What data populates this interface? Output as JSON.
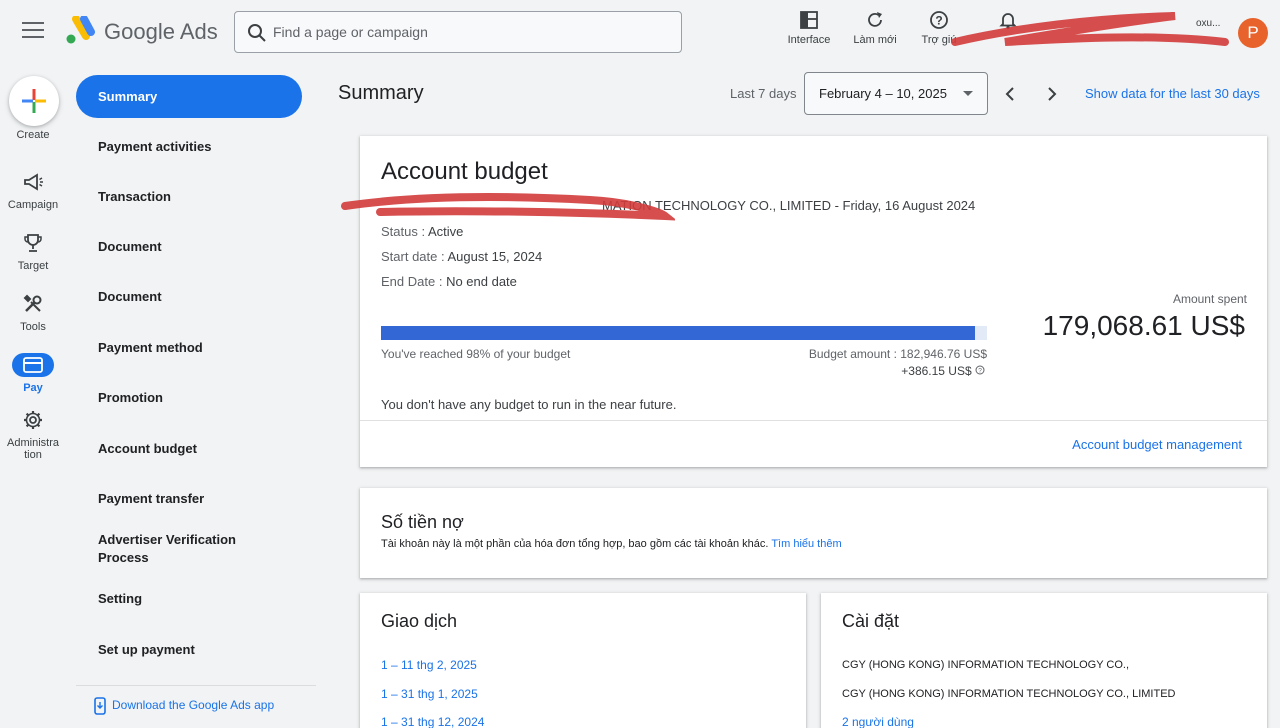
{
  "header": {
    "brand": "Google Ads",
    "search_placeholder": "Find a page or campaign",
    "actions": [
      {
        "label": "Interface",
        "icon": "layout-icon"
      },
      {
        "label": "Làm mới",
        "icon": "refresh-icon"
      },
      {
        "label": "Trợ giú",
        "icon": "help-icon"
      },
      {
        "label": "",
        "icon": "bell-icon"
      }
    ],
    "account_name": "oxu...",
    "avatar_letter": "P"
  },
  "rail": {
    "create": "Create",
    "items": [
      {
        "label": "Campaign",
        "icon": "megaphone-icon"
      },
      {
        "label": "Target",
        "icon": "trophy-icon"
      },
      {
        "label": "Tools",
        "icon": "tools-icon"
      },
      {
        "label": "Pay",
        "icon": "credit-card-icon"
      },
      {
        "label": "Administra tion",
        "icon": "gear-icon"
      }
    ]
  },
  "nav": {
    "items": [
      {
        "label": "Summary",
        "active": true
      },
      {
        "label": "Payment activities"
      },
      {
        "label": "Transaction"
      },
      {
        "label": "Document"
      },
      {
        "label": "Document"
      },
      {
        "label": "Payment method"
      },
      {
        "label": "Promotion"
      },
      {
        "label": "Account budget"
      },
      {
        "label": "Payment transfer"
      },
      {
        "label": "Advertiser Verification Process"
      },
      {
        "label": "Setting"
      },
      {
        "label": "Set up payment"
      }
    ],
    "download": "Download the Google Ads app"
  },
  "page": {
    "title": "Summary",
    "range_label": "Last 7 days",
    "date_range": "February 4 – 10, 2025",
    "last30_link": "Show data for the last 30 days"
  },
  "budget": {
    "title": "Account budget",
    "fund_name": "MATION TECHNOLOGY CO., LIMITED - Friday, 16 August 2024",
    "status_label": "Status :",
    "status": "Active",
    "start_label": "Start date :",
    "start": "August 15, 2024",
    "end_label": "End Date :",
    "end": "No end date",
    "progress_fraction": 0.98,
    "reached_text": "You've reached 98% of your budget",
    "budget_amount": "Budget amount : 182,946.76 US$",
    "budget_extra": "+386.15 US$",
    "amount_spent_label": "Amount spent",
    "amount_spent": "179,068.61 US$",
    "no_budget_text": "You don't have any budget to run in the near future.",
    "management_link": "Account budget management"
  },
  "debt": {
    "title": "Số tiền nợ",
    "description": "Tài khoản này là một phần của hóa đơn tổng hợp, bao gồm các tài khoản khác.",
    "learn_more": "Tìm hiểu thêm"
  },
  "transactions": {
    "title": "Giao dịch",
    "items": [
      "1 – 11 thg 2, 2025",
      "1 – 31 thg 1, 2025",
      "1 – 31 thg 12, 2024"
    ]
  },
  "settings": {
    "title": "Cài đặt",
    "lines": [
      "CGY (HONG KONG) INFORMATION TECHNOLOGY CO.,",
      "CGY (HONG KONG) INFORMATION TECHNOLOGY CO., LIMITED"
    ],
    "users_link": "2 người dùng"
  },
  "colors": {
    "accent": "#1a73e8",
    "progress": "#3367d6",
    "avatar": "#e8622c",
    "redaction": "#d23b3b"
  }
}
